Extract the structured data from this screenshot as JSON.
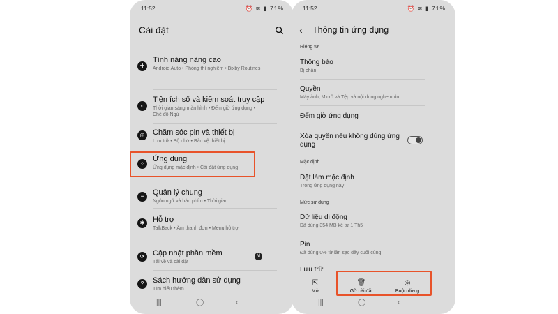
{
  "status": {
    "time": "11:52",
    "battery": "71%"
  },
  "left": {
    "title": "Cài đặt",
    "items": [
      {
        "label": "Tính năng nâng cao",
        "sub": "Android Auto • Phòng thí nghiệm • Bixby Routines"
      },
      {
        "label": "Tiện ích số và kiểm soát truy cập",
        "sub": "Thời gian sáng màn hình • Đếm giờ ứng dụng • Chế độ Ngủ"
      },
      {
        "label": "Chăm sóc pin và thiết bị",
        "sub": "Lưu trữ • Bộ nhớ • Bảo vệ thiết bị"
      },
      {
        "label": "Ứng dụng",
        "sub": "Ứng dụng mặc định • Cài đặt ứng dụng"
      },
      {
        "label": "Quản lý chung",
        "sub": "Ngôn ngữ và bàn phím • Thời gian"
      },
      {
        "label": "Hỗ trợ",
        "sub": "TalkBack • Âm thanh đơn • Menu hỗ trợ"
      },
      {
        "label": "Cập nhật phần mềm",
        "sub": "Tải về và cài đặt",
        "badge": "M"
      },
      {
        "label": "Sách hướng dẫn sử dụng",
        "sub": "Tìm hiểu thêm"
      }
    ]
  },
  "right": {
    "title": "Thông tin ứng dụng",
    "sections": {
      "privacy": "Riêng tư",
      "default": "Mặc định",
      "usage": "Mức sử dụng"
    },
    "items": {
      "notifications": {
        "label": "Thông báo",
        "sub": "Bị chặn"
      },
      "permissions": {
        "label": "Quyền",
        "sub": "Máy ảnh, Micrô và Tệp và nội dung nghe nhìn"
      },
      "screen_time": {
        "label": "Đếm giờ ứng dụng"
      },
      "remove_perms": {
        "label": "Xóa quyền nếu không dùng ứng dụng",
        "toggle": true
      },
      "set_default": {
        "label": "Đặt làm mặc định",
        "sub": "Trong ứng dụng này"
      },
      "mobile_data": {
        "label": "Dữ liệu di động",
        "sub": "Đã dùng 354 MB kể từ 1 Th5"
      },
      "battery": {
        "label": "Pin",
        "sub": "Đã dùng 0% từ lần sạc đầy cuối cùng"
      },
      "storage": {
        "label": "Lưu trữ"
      }
    },
    "bottom": {
      "open": "Mở",
      "uninstall": "Gỡ cài đặt",
      "force_stop": "Buộc dừng"
    }
  },
  "colors": {
    "highlight": "#e8532a",
    "phone_bg": "#dcdcdc"
  }
}
